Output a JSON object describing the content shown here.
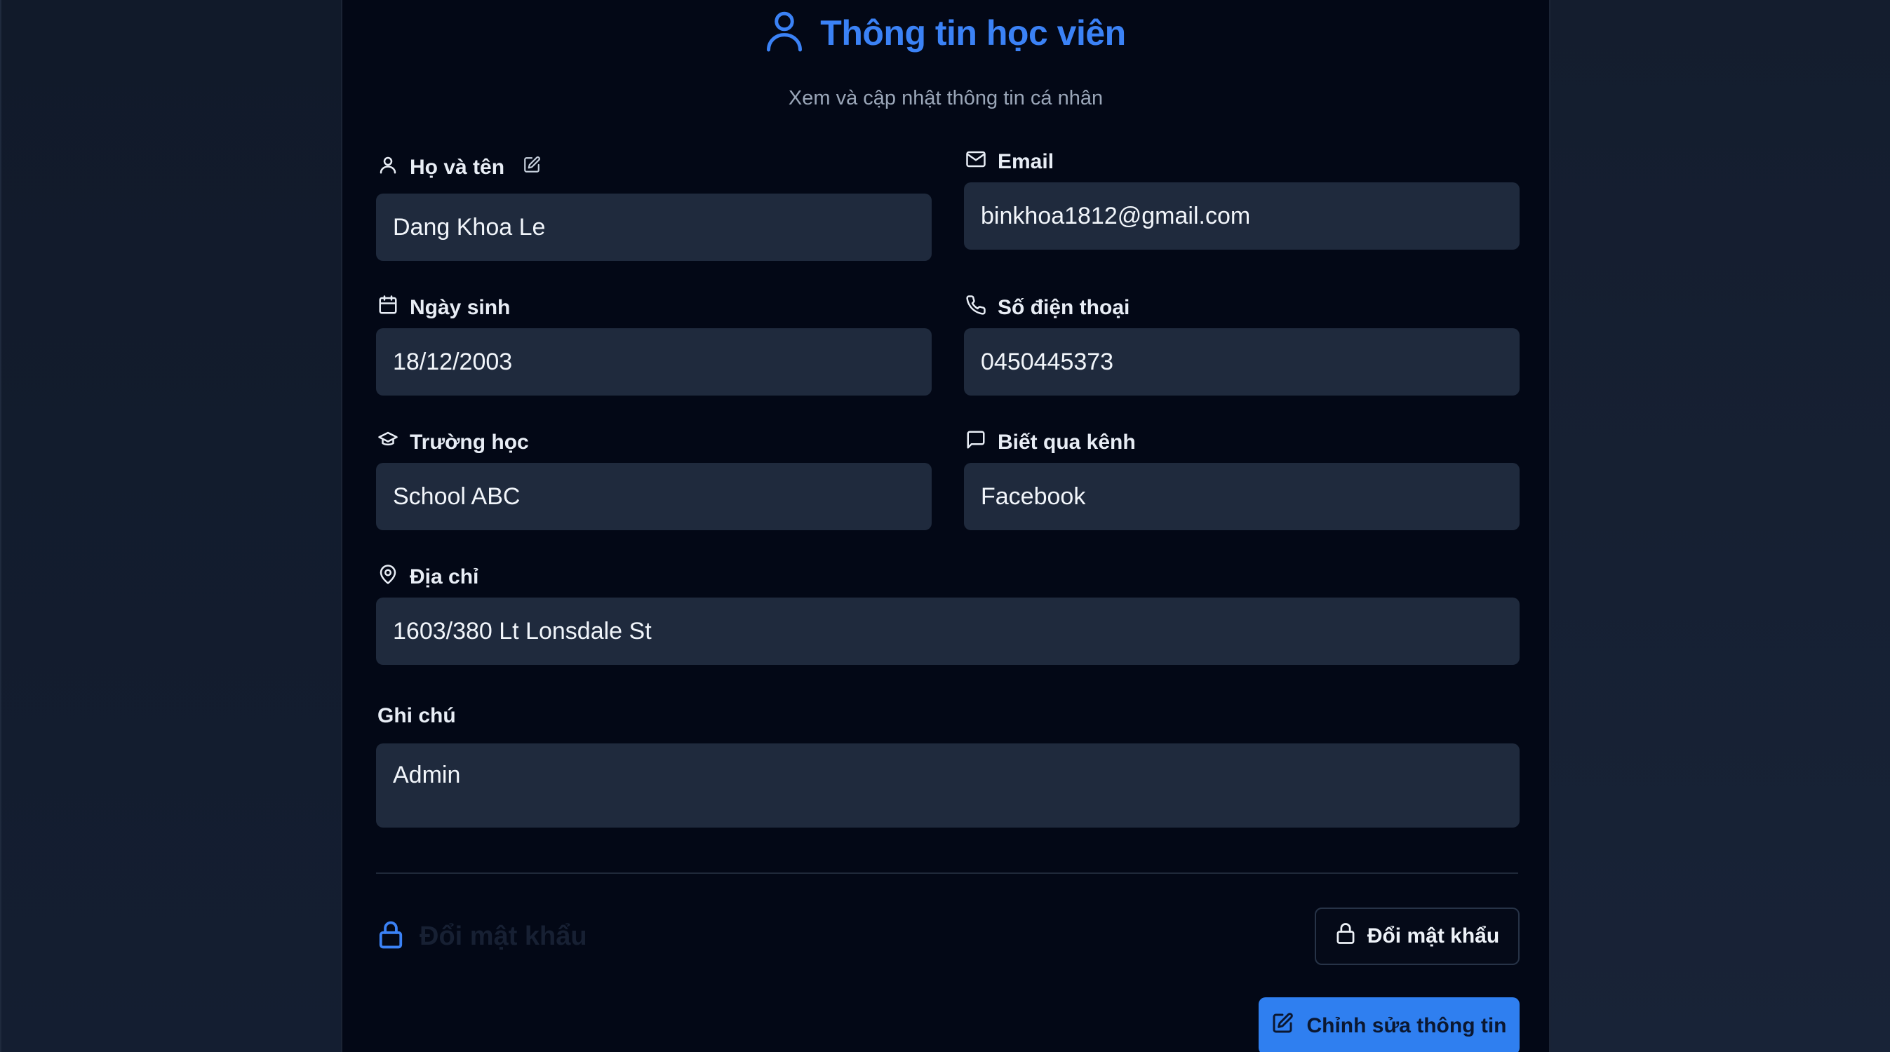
{
  "header": {
    "title": "Thông tin học viên",
    "subtitle": "Xem và cập nhật thông tin cá nhân",
    "icon": "user-icon",
    "accent_color": "#3b82f6"
  },
  "fields": {
    "full_name": {
      "label": "Họ và tên",
      "value": "Dang Khoa Le",
      "icon": "user-icon"
    },
    "email": {
      "label": "Email",
      "value": "binkhoa1812@gmail.com",
      "icon": "mail-icon"
    },
    "birthday": {
      "label": "Ngày sinh",
      "value": "18/12/2003",
      "icon": "calendar-icon"
    },
    "phone": {
      "label": "Số điện thoại",
      "value": "0450445373",
      "icon": "phone-icon"
    },
    "school": {
      "label": "Trường học",
      "value": "School ABC",
      "icon": "graduation-cap-icon"
    },
    "source": {
      "label": "Biết qua kênh",
      "value": "Facebook",
      "icon": "message-square-icon"
    },
    "address": {
      "label": "Địa chỉ",
      "value": "1603/380 Lt Lonsdale St",
      "icon": "map-pin-icon"
    },
    "note": {
      "label": "Ghi chú",
      "value": "Admin"
    }
  },
  "password": {
    "section_title": "Đổi mật khẩu",
    "button_label": "Đổi mật khẩu",
    "icon": "lock-icon"
  },
  "actions": {
    "edit_label": "Chỉnh sửa thông tin",
    "edit_icon": "edit-icon",
    "primary_color": "#2f7ff0"
  }
}
